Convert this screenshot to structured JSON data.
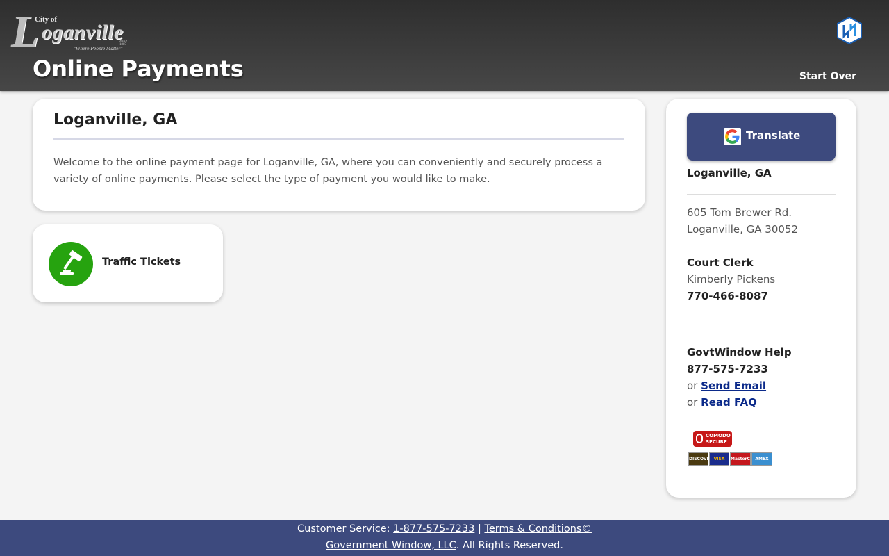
{
  "header": {
    "logo": {
      "city_of": "City of",
      "big_letter": "L",
      "name_rest": "oganville",
      "since": "Since 1887",
      "tagline": "\"Where People Matter\""
    },
    "title": "Online Payments",
    "start_over": "Start Over"
  },
  "welcome": {
    "city": "Loganville, GA",
    "text": "Welcome to the online payment page for Loganville, GA, where you can conveniently and securely process a variety of online payments. Please select the type of payment you would like to make."
  },
  "payment_types": [
    {
      "label": "Traffic Tickets",
      "icon": "gavel-icon"
    }
  ],
  "sidebar": {
    "translate_label": "Translate",
    "city": "Loganville, GA",
    "address_line1": "605 Tom Brewer Rd.",
    "address_line2": "Loganville, GA 30052",
    "clerk_title": "Court Clerk",
    "clerk_name": "Kimberly Pickens",
    "clerk_phone": "770-466-8087",
    "help_title": "GovtWindow Help",
    "help_phone": "877-575-7233",
    "or1": "or",
    "send_email": "Send Email",
    "or2": "or",
    "read_faq": "Read FAQ",
    "comodo_line1": "COMODO",
    "comodo_line2": "SECURE",
    "cards": [
      "DISCOVER",
      "VISA",
      "MasterCard",
      "AMEX"
    ]
  },
  "footer": {
    "cs_prefix": "Customer Service: ",
    "cs_phone": "1-877-575-7233",
    "sep": " | ",
    "terms": "Terms & Conditions©",
    "company": "Government Window, LLC",
    "rights": ". All Rights Reserved."
  },
  "colors": {
    "header_bg": "#3a3a3a",
    "accent_navy": "#3d4a7e",
    "gavel_green": "#26a30f",
    "link": "#0b2a8a"
  }
}
